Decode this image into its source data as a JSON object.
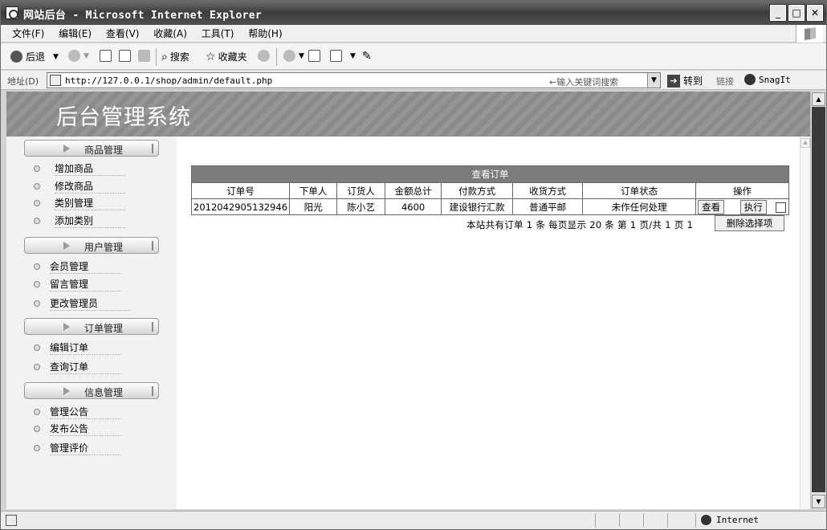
{
  "window": {
    "title": "网站后台 - Microsoft Internet Explorer",
    "minimize": "_",
    "maximize": "□",
    "close": "✕"
  },
  "menu": [
    "文件(F)",
    "编辑(E)",
    "查看(V)",
    "收藏(A)",
    "工具(T)",
    "帮助(H)"
  ],
  "toolbar": {
    "back": "后退",
    "search": "搜索",
    "favorites": "收藏夹"
  },
  "address": {
    "label": "地址(D)",
    "url": "http://127.0.0.1/shop/admin/default.php",
    "hint": "←输入关键词搜索",
    "go": "转到",
    "links": "链接",
    "snagit": "SnagIt"
  },
  "banner": {
    "title": "后台管理系统"
  },
  "sidebar": {
    "sections": [
      {
        "title": "商品管理",
        "items": [
          "增加商品",
          "修改商品",
          "类别管理",
          "添加类别"
        ]
      },
      {
        "title": "用户管理",
        "items": [
          "会员管理",
          "留言管理",
          "更改管理员"
        ]
      },
      {
        "title": "订单管理",
        "items": [
          "编辑订单",
          "查询订单"
        ]
      },
      {
        "title": "信息管理",
        "items": [
          "管理公告",
          "发布公告",
          "管理评价"
        ]
      }
    ]
  },
  "orders": {
    "caption": "查看订单",
    "headers": [
      "订单号",
      "下单人",
      "订货人",
      "金额总计",
      "付款方式",
      "收货方式",
      "订单状态",
      "操作"
    ],
    "rows": [
      {
        "order_no": "2012042905132946",
        "buyer": "阳光",
        "receiver": "陈小艺",
        "total": "4600",
        "payment": "建设银行汇款",
        "shipping": "普通平邮",
        "status": "未作任何处理",
        "view": "查看",
        "execute": "执行"
      }
    ],
    "pager": "本站共有订单 1  条 每页显示 20 条 第 1 页/共 1 页 1",
    "delete_button": "删除选择项"
  },
  "status": {
    "zone": "Internet"
  }
}
